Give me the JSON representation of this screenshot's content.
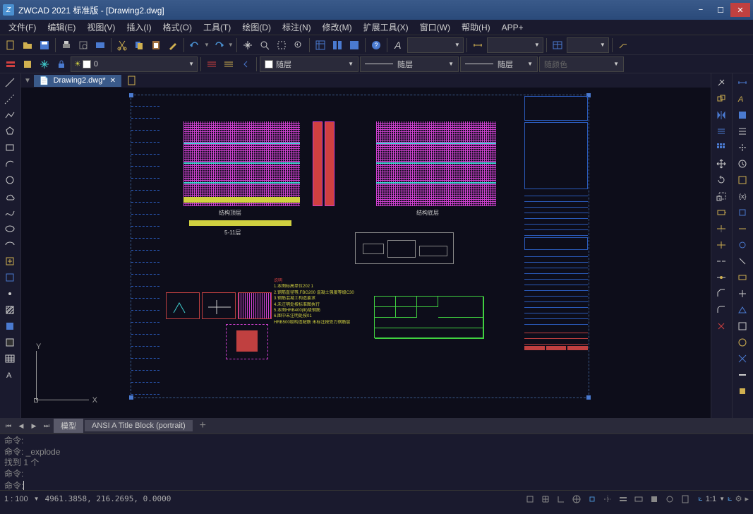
{
  "titlebar": {
    "app_name": "ZWCAD 2021 标准版 - [Drawing2.dwg]",
    "minimize": "−",
    "maximize": "☐",
    "close": "✕"
  },
  "menu": {
    "file": "文件(F)",
    "edit": "编辑(E)",
    "view": "视图(V)",
    "insert": "插入(I)",
    "format": "格式(O)",
    "tools": "工具(T)",
    "draw": "绘图(D)",
    "dim": "标注(N)",
    "modify": "修改(M)",
    "extend": "扩展工具(X)",
    "window": "窗口(W)",
    "help": "帮助(H)",
    "app": "APP+"
  },
  "layer": {
    "current": "0",
    "color_bylayer": "随层",
    "linetype_bylayer": "随层",
    "lineweight_bylayer": "随层",
    "color_random": "随颜色"
  },
  "document": {
    "tab_name": "Drawing2.dwg*",
    "tab_close": "✕"
  },
  "ucs": {
    "x": "X",
    "y": "Y"
  },
  "drawing": {
    "plan1_label": "结构顶层",
    "plan2_label": "结构底层",
    "beam_label": "5-11层",
    "notes_title": "说明",
    "notes_1": "1.本图标高单位202 1",
    "notes_2": "2.钢筋直径等,FBG200 混凝土强度等级C30",
    "notes_3": "3.钢筋混凝土构造要求",
    "notes_4": "4.未注明处按标准图执行",
    "notes_5": "5.本图HRB400(Ⅲ)级钢筋",
    "notes_6": "6.图中未注明处按01",
    "notes_7": "HRB500级构造配筋 未标注按受力钢筋层"
  },
  "bottom_tabs": {
    "model": "模型",
    "layout1": "ANSI A Title Block (portrait)",
    "add": "+"
  },
  "command": {
    "line1": "命令:",
    "line2": "命令: _explode",
    "line3": "找到 1 个",
    "line4": "命令:",
    "prompt": "命令:"
  },
  "statusbar": {
    "scale": "1 : 100",
    "coords": "4961.3858, 216.2695, 0.0000",
    "iso": "1:1",
    "arrow": "▼"
  },
  "colors": {
    "accent": "#4a7ad0",
    "magenta": "#d040d0",
    "cyan": "#40d0d0",
    "yellow": "#d0d040",
    "red": "#c04040",
    "green": "#40d040"
  }
}
